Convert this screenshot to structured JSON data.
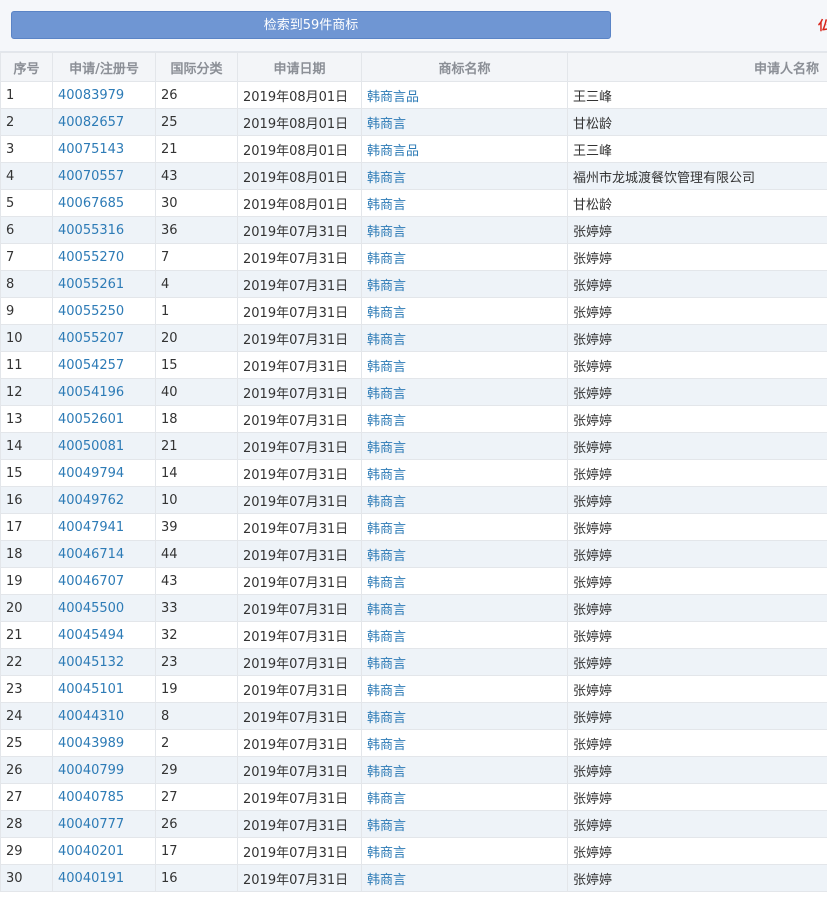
{
  "header": {
    "result_button_label": "检索到59件商标",
    "edge_glyph": "仏"
  },
  "table": {
    "columns": [
      "序号",
      "申请/注册号",
      "国际分类",
      "申请日期",
      "商标名称",
      "申请人名称"
    ],
    "rows": [
      {
        "no": "1",
        "reg_no": "40083979",
        "class": "26",
        "date": "2019年08月01日",
        "name": "韩商言品",
        "applicant": "王三峰"
      },
      {
        "no": "2",
        "reg_no": "40082657",
        "class": "25",
        "date": "2019年08月01日",
        "name": "韩商言",
        "applicant": "甘松龄"
      },
      {
        "no": "3",
        "reg_no": "40075143",
        "class": "21",
        "date": "2019年08月01日",
        "name": "韩商言品",
        "applicant": "王三峰"
      },
      {
        "no": "4",
        "reg_no": "40070557",
        "class": "43",
        "date": "2019年08月01日",
        "name": "韩商言",
        "applicant": "福州市龙城渡餐饮管理有限公司"
      },
      {
        "no": "5",
        "reg_no": "40067685",
        "class": "30",
        "date": "2019年08月01日",
        "name": "韩商言",
        "applicant": "甘松龄"
      },
      {
        "no": "6",
        "reg_no": "40055316",
        "class": "36",
        "date": "2019年07月31日",
        "name": "韩商言",
        "applicant": "张婷婷"
      },
      {
        "no": "7",
        "reg_no": "40055270",
        "class": "7",
        "date": "2019年07月31日",
        "name": "韩商言",
        "applicant": "张婷婷"
      },
      {
        "no": "8",
        "reg_no": "40055261",
        "class": "4",
        "date": "2019年07月31日",
        "name": "韩商言",
        "applicant": "张婷婷"
      },
      {
        "no": "9",
        "reg_no": "40055250",
        "class": "1",
        "date": "2019年07月31日",
        "name": "韩商言",
        "applicant": "张婷婷"
      },
      {
        "no": "10",
        "reg_no": "40055207",
        "class": "20",
        "date": "2019年07月31日",
        "name": "韩商言",
        "applicant": "张婷婷"
      },
      {
        "no": "11",
        "reg_no": "40054257",
        "class": "15",
        "date": "2019年07月31日",
        "name": "韩商言",
        "applicant": "张婷婷"
      },
      {
        "no": "12",
        "reg_no": "40054196",
        "class": "40",
        "date": "2019年07月31日",
        "name": "韩商言",
        "applicant": "张婷婷"
      },
      {
        "no": "13",
        "reg_no": "40052601",
        "class": "18",
        "date": "2019年07月31日",
        "name": "韩商言",
        "applicant": "张婷婷"
      },
      {
        "no": "14",
        "reg_no": "40050081",
        "class": "21",
        "date": "2019年07月31日",
        "name": "韩商言",
        "applicant": "张婷婷"
      },
      {
        "no": "15",
        "reg_no": "40049794",
        "class": "14",
        "date": "2019年07月31日",
        "name": "韩商言",
        "applicant": "张婷婷"
      },
      {
        "no": "16",
        "reg_no": "40049762",
        "class": "10",
        "date": "2019年07月31日",
        "name": "韩商言",
        "applicant": "张婷婷"
      },
      {
        "no": "17",
        "reg_no": "40047941",
        "class": "39",
        "date": "2019年07月31日",
        "name": "韩商言",
        "applicant": "张婷婷"
      },
      {
        "no": "18",
        "reg_no": "40046714",
        "class": "44",
        "date": "2019年07月31日",
        "name": "韩商言",
        "applicant": "张婷婷"
      },
      {
        "no": "19",
        "reg_no": "40046707",
        "class": "43",
        "date": "2019年07月31日",
        "name": "韩商言",
        "applicant": "张婷婷"
      },
      {
        "no": "20",
        "reg_no": "40045500",
        "class": "33",
        "date": "2019年07月31日",
        "name": "韩商言",
        "applicant": "张婷婷"
      },
      {
        "no": "21",
        "reg_no": "40045494",
        "class": "32",
        "date": "2019年07月31日",
        "name": "韩商言",
        "applicant": "张婷婷"
      },
      {
        "no": "22",
        "reg_no": "40045132",
        "class": "23",
        "date": "2019年07月31日",
        "name": "韩商言",
        "applicant": "张婷婷"
      },
      {
        "no": "23",
        "reg_no": "40045101",
        "class": "19",
        "date": "2019年07月31日",
        "name": "韩商言",
        "applicant": "张婷婷"
      },
      {
        "no": "24",
        "reg_no": "40044310",
        "class": "8",
        "date": "2019年07月31日",
        "name": "韩商言",
        "applicant": "张婷婷"
      },
      {
        "no": "25",
        "reg_no": "40043989",
        "class": "2",
        "date": "2019年07月31日",
        "name": "韩商言",
        "applicant": "张婷婷"
      },
      {
        "no": "26",
        "reg_no": "40040799",
        "class": "29",
        "date": "2019年07月31日",
        "name": "韩商言",
        "applicant": "张婷婷"
      },
      {
        "no": "27",
        "reg_no": "40040785",
        "class": "27",
        "date": "2019年07月31日",
        "name": "韩商言",
        "applicant": "张婷婷"
      },
      {
        "no": "28",
        "reg_no": "40040777",
        "class": "26",
        "date": "2019年07月31日",
        "name": "韩商言",
        "applicant": "张婷婷"
      },
      {
        "no": "29",
        "reg_no": "40040201",
        "class": "17",
        "date": "2019年07月31日",
        "name": "韩商言",
        "applicant": "张婷婷"
      },
      {
        "no": "30",
        "reg_no": "40040191",
        "class": "16",
        "date": "2019年07月31日",
        "name": "韩商言",
        "applicant": "张婷婷"
      }
    ]
  },
  "colors": {
    "button_bg": "#6f96d3",
    "link": "#2d7bb6",
    "row_alt": "#eef3f8",
    "header_bg": "#f3f5f8"
  }
}
